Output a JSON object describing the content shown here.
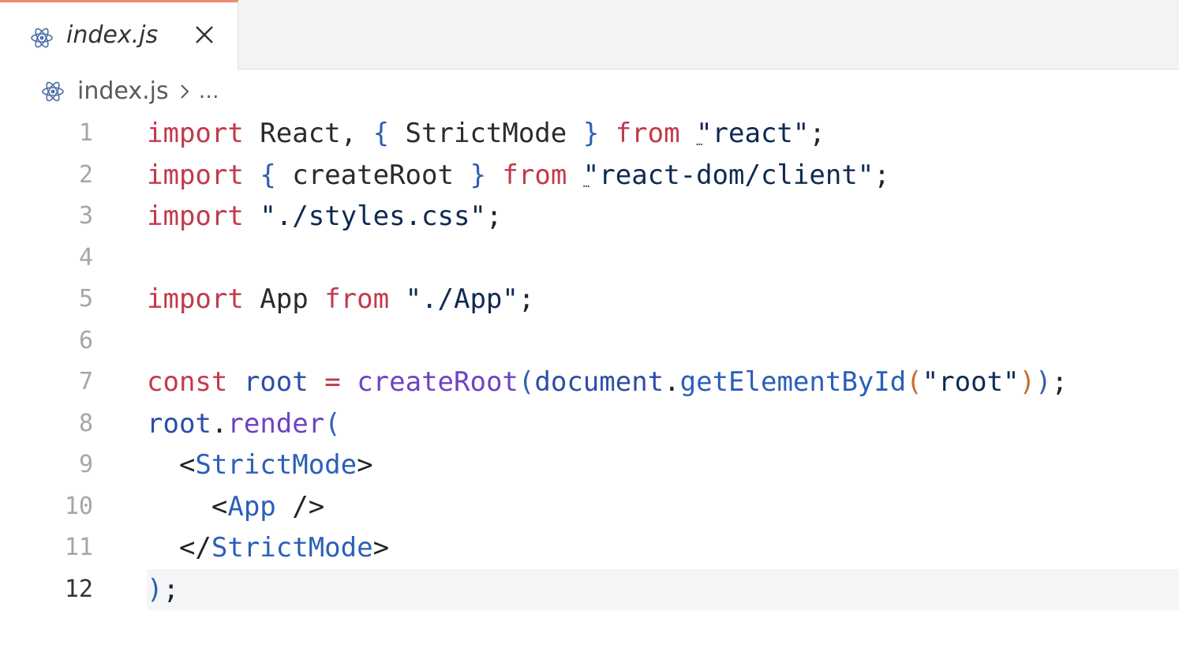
{
  "tab": {
    "label": "index.js",
    "icon": "react-icon"
  },
  "breadcrumb": {
    "file": "index.js",
    "more": "…"
  },
  "editor": {
    "current_line": 12,
    "lines": [
      {
        "n": "1",
        "tokens": [
          {
            "t": "import",
            "c": "kw"
          },
          {
            "t": " React, ",
            "c": "id"
          },
          {
            "t": "{",
            "c": "br"
          },
          {
            "t": " StrictMode ",
            "c": "id"
          },
          {
            "t": "}",
            "c": "br"
          },
          {
            "t": " ",
            "c": "id"
          },
          {
            "t": "from",
            "c": "kw"
          },
          {
            "t": " ",
            "c": "id"
          },
          {
            "t": "\"",
            "c": "str",
            "hint": "…"
          },
          {
            "t": "react\"",
            "c": "str"
          },
          {
            "t": ";",
            "c": "punc"
          }
        ]
      },
      {
        "n": "2",
        "tokens": [
          {
            "t": "import",
            "c": "kw"
          },
          {
            "t": " ",
            "c": "id"
          },
          {
            "t": "{",
            "c": "br"
          },
          {
            "t": " createRoot ",
            "c": "id"
          },
          {
            "t": "}",
            "c": "br"
          },
          {
            "t": " ",
            "c": "id"
          },
          {
            "t": "from",
            "c": "kw"
          },
          {
            "t": " ",
            "c": "id"
          },
          {
            "t": "\"",
            "c": "str",
            "hint": "…"
          },
          {
            "t": "react-dom/client\"",
            "c": "str"
          },
          {
            "t": ";",
            "c": "punc"
          }
        ]
      },
      {
        "n": "3",
        "tokens": [
          {
            "t": "import",
            "c": "kw"
          },
          {
            "t": " ",
            "c": "id"
          },
          {
            "t": "\"./styles.css\"",
            "c": "str"
          },
          {
            "t": ";",
            "c": "punc"
          }
        ]
      },
      {
        "n": "4",
        "tokens": []
      },
      {
        "n": "5",
        "tokens": [
          {
            "t": "import",
            "c": "kw"
          },
          {
            "t": " App ",
            "c": "id"
          },
          {
            "t": "from",
            "c": "kw"
          },
          {
            "t": " ",
            "c": "id"
          },
          {
            "t": "\"./App\"",
            "c": "str"
          },
          {
            "t": ";",
            "c": "punc"
          }
        ]
      },
      {
        "n": "6",
        "tokens": []
      },
      {
        "n": "7",
        "tokens": [
          {
            "t": "const",
            "c": "kw"
          },
          {
            "t": " ",
            "c": "id"
          },
          {
            "t": "root",
            "c": "var"
          },
          {
            "t": " ",
            "c": "id"
          },
          {
            "t": "=",
            "c": "op"
          },
          {
            "t": " ",
            "c": "id"
          },
          {
            "t": "createRoot",
            "c": "fn"
          },
          {
            "t": "(",
            "c": "br"
          },
          {
            "t": "document",
            "c": "var"
          },
          {
            "t": ".",
            "c": "punc"
          },
          {
            "t": "getElementById",
            "c": "prop"
          },
          {
            "t": "(",
            "c": "paren2"
          },
          {
            "t": "\"root\"",
            "c": "str"
          },
          {
            "t": ")",
            "c": "paren2"
          },
          {
            "t": ")",
            "c": "br"
          },
          {
            "t": ";",
            "c": "punc"
          }
        ]
      },
      {
        "n": "8",
        "tokens": [
          {
            "t": "root",
            "c": "var"
          },
          {
            "t": ".",
            "c": "punc"
          },
          {
            "t": "render",
            "c": "fn"
          },
          {
            "t": "(",
            "c": "br"
          }
        ]
      },
      {
        "n": "9",
        "tokens": [
          {
            "t": "  <",
            "c": "punc"
          },
          {
            "t": "StrictMode",
            "c": "tag"
          },
          {
            "t": ">",
            "c": "punc"
          }
        ]
      },
      {
        "n": "10",
        "tokens": [
          {
            "t": "    <",
            "c": "punc"
          },
          {
            "t": "App",
            "c": "tag"
          },
          {
            "t": " />",
            "c": "punc"
          }
        ]
      },
      {
        "n": "11",
        "tokens": [
          {
            "t": "  </",
            "c": "punc"
          },
          {
            "t": "StrictMode",
            "c": "tag"
          },
          {
            "t": ">",
            "c": "punc"
          }
        ]
      },
      {
        "n": "12",
        "tokens": [
          {
            "t": ")",
            "c": "br"
          },
          {
            "t": ";",
            "c": "punc"
          }
        ]
      }
    ]
  }
}
